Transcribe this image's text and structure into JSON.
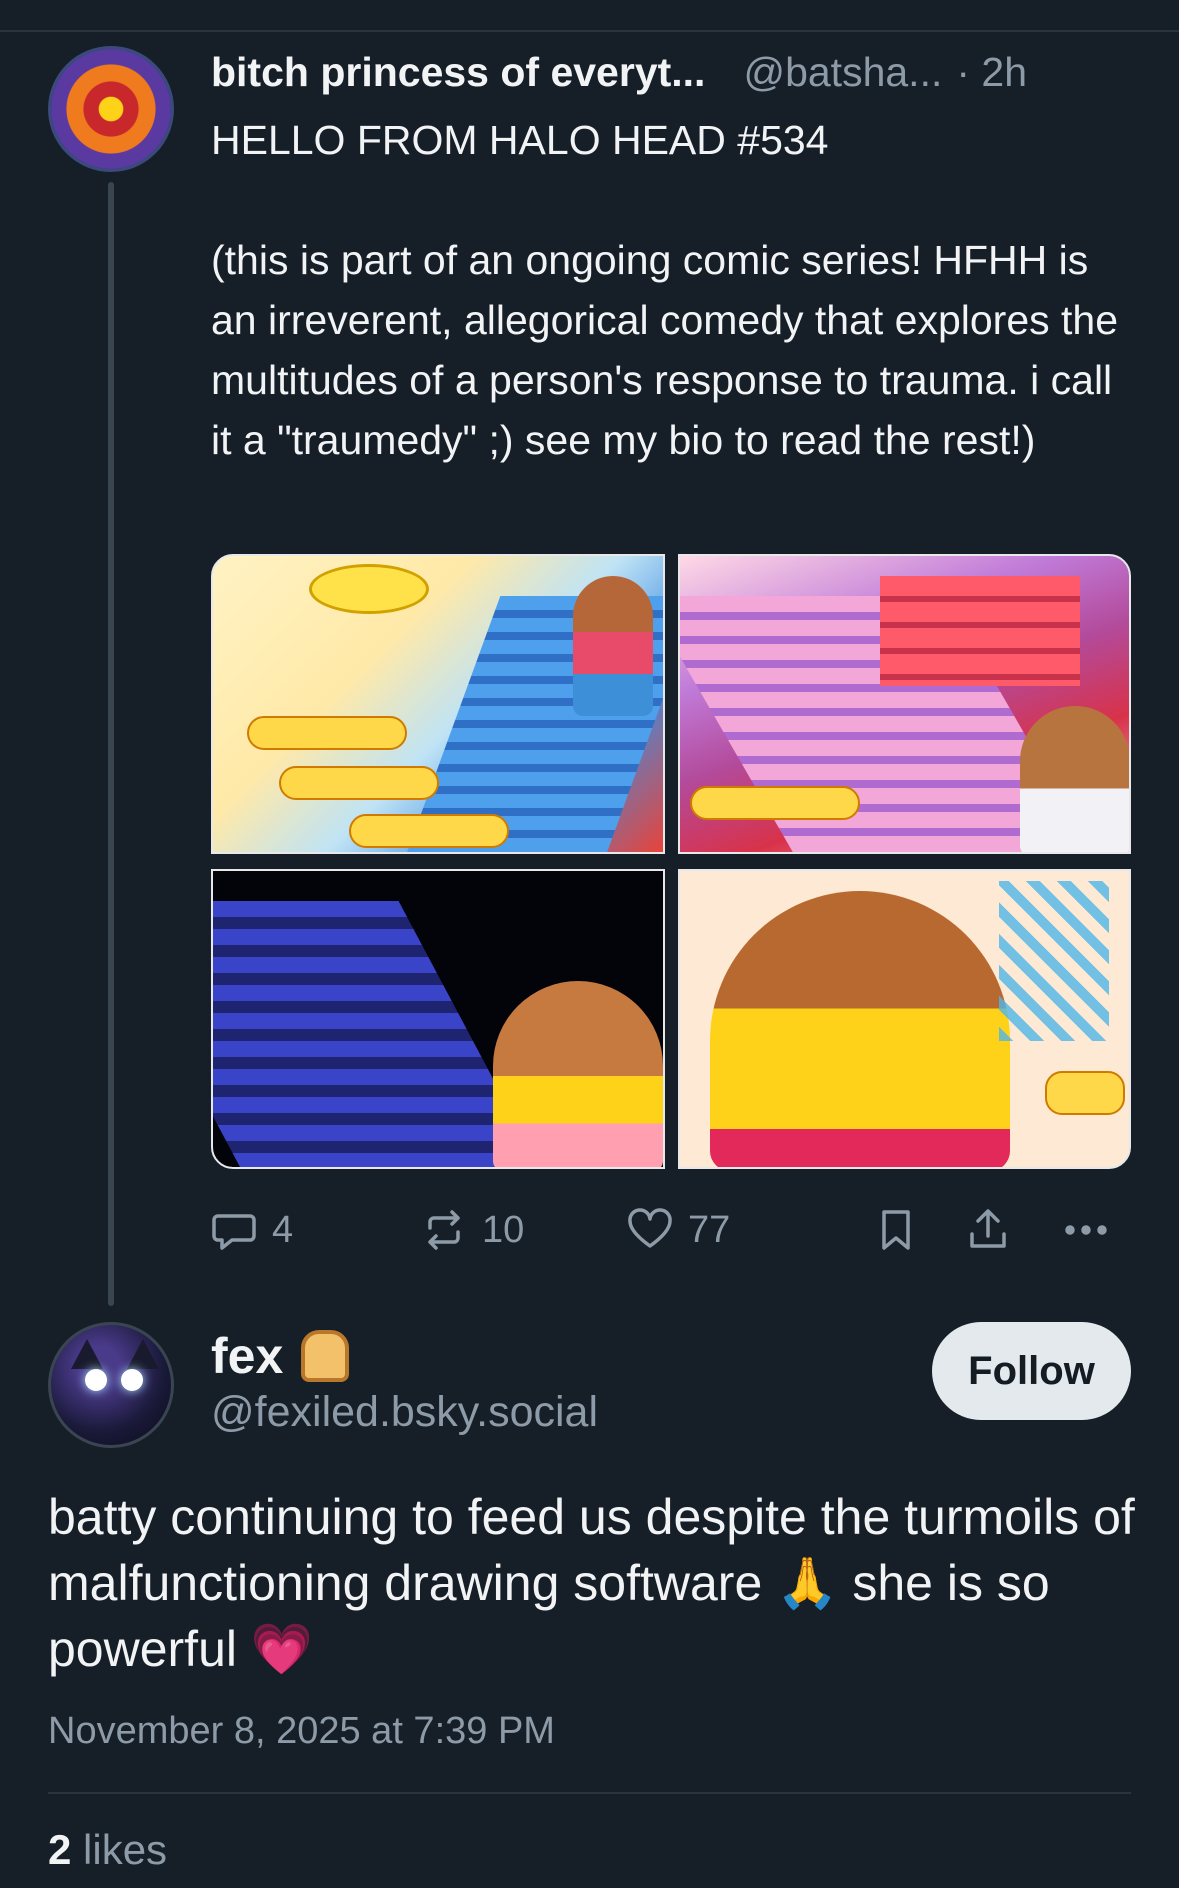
{
  "parent_post": {
    "display_name": "bitch princess of everyt...",
    "handle": "@batsha...",
    "time": "· 2h",
    "text": "HELLO FROM HALO HEAD #534\n\n(this is part of an ongoing comic series! HFHH is an irreverent, allegorical comedy that explores the multitudes of a person's response to trauma. i call it a \"traumedy\" ;) see my bio to read the rest!)",
    "actions": {
      "reply_count": "4",
      "repost_count": "10",
      "like_count": "77"
    }
  },
  "reply_post": {
    "display_name": "fex",
    "name_emoji": "bread-icon",
    "handle": "@fexiled.bsky.social",
    "follow_label": "Follow",
    "text_part1": "batty continuing to feed us despite the turmoils of malfunctioning drawing software",
    "emoji_pray": "🙏",
    "text_part2": " she is so powerful ",
    "emoji_heart": "💗",
    "date": "November 8, 2025 at 7:39 PM",
    "likes_count": "2",
    "likes_label": " likes"
  },
  "colors": {
    "background": "#161e27",
    "text": "#f1f3f5",
    "muted": "#8d9aa8",
    "follow_bg": "#e4e9ee"
  }
}
